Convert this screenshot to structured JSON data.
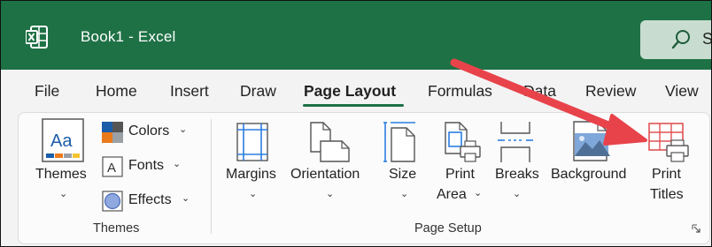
{
  "window": {
    "title": "Book1  -  Excel",
    "search_letter": "S"
  },
  "colors": {
    "brand_green": "#1e7145",
    "arrow_red": "#e8434b"
  },
  "tabs": [
    {
      "label": "File"
    },
    {
      "label": "Home"
    },
    {
      "label": "Insert"
    },
    {
      "label": "Draw"
    },
    {
      "label": "Page Layout",
      "active": true
    },
    {
      "label": "Formulas"
    },
    {
      "label": "Data"
    },
    {
      "label": "Review"
    },
    {
      "label": "View"
    }
  ],
  "themes_group": {
    "label": "Themes",
    "themes_button": "Themes",
    "colors_button": "Colors",
    "fonts_button": "Fonts",
    "effects_button": "Effects"
  },
  "page_setup_group": {
    "label": "Page Setup",
    "margins": "Margins",
    "orientation": "Orientation",
    "size": "Size",
    "print_area_line1": "Print",
    "print_area_line2": "Area",
    "breaks": "Breaks",
    "background": "Background",
    "print_titles_line1": "Print",
    "print_titles_line2": "Titles"
  },
  "icons": [
    "excel-logo",
    "search-icon",
    "themes-icon",
    "colors-icon",
    "fonts-icon",
    "effects-icon",
    "margins-icon",
    "orientation-icon",
    "size-icon",
    "print-area-icon",
    "breaks-icon",
    "background-icon",
    "print-titles-icon",
    "dialog-launcher-icon"
  ]
}
